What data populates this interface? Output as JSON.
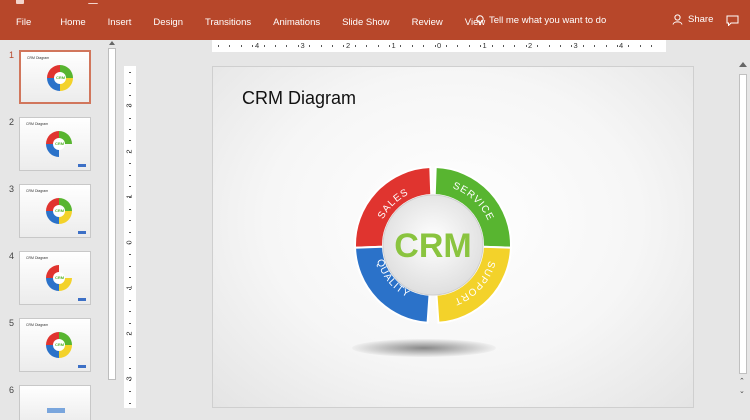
{
  "ribbon": {
    "tabs": [
      "File",
      "Home",
      "Insert",
      "Design",
      "Transitions",
      "Animations",
      "Slide Show",
      "Review",
      "View"
    ],
    "tell_me": "Tell me what you want to do",
    "share": "Share",
    "color": "#b7472a"
  },
  "thumbnails": [
    {
      "number": "1",
      "title": "CRM Diagram",
      "active": true
    },
    {
      "number": "2",
      "title": "CRM Diagram",
      "active": false
    },
    {
      "number": "3",
      "title": "CRM Diagram",
      "active": false
    },
    {
      "number": "4",
      "title": "CRM Diagram",
      "active": false
    },
    {
      "number": "5",
      "title": "CRM Diagram",
      "active": false
    },
    {
      "number": "6",
      "title": "",
      "active": false
    }
  ],
  "rulers": {
    "horizontal": [
      "4",
      "3",
      "2",
      "1",
      "0",
      "1",
      "2",
      "3",
      "4"
    ],
    "vertical": [
      "3",
      "2",
      "1",
      "0",
      "1",
      "2",
      "3"
    ]
  },
  "slide": {
    "title": "CRM Diagram",
    "diagram": {
      "center": "CRM",
      "segments": [
        {
          "label": "SALES",
          "color": "#e0342f"
        },
        {
          "label": "SERVICE",
          "color": "#58b530"
        },
        {
          "label": "SUPPORT",
          "color": "#f3d22a"
        },
        {
          "label": "QUALITY",
          "color": "#2b72c9"
        }
      ],
      "center_color": "#8ac43f"
    }
  }
}
